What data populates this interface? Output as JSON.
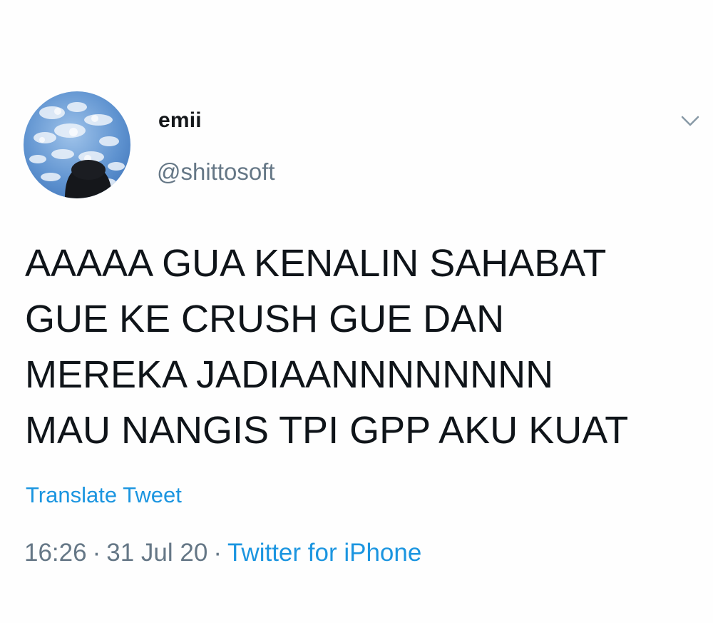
{
  "tweet": {
    "author": {
      "display_name": "emii",
      "handle": "@shittosoft",
      "avatar_icon": "sky-clouds-avatar"
    },
    "menu_icon": "chevron-down-icon",
    "text_lines": [
      "AAAAA GUA KENALIN SAHABAT",
      "GUE KE CRUSH GUE DAN",
      "MEREKA JADIAANNNNNNNN",
      "MAU NANGIS TPI GPP AKU KUAT"
    ],
    "translate_label": "Translate Tweet",
    "time": "16:26",
    "separator": "·",
    "date": "31 Jul 20",
    "source": "Twitter for iPhone",
    "colors": {
      "link": "#1b95e0",
      "secondary_text": "#657786",
      "primary_text": "#14171a"
    }
  }
}
